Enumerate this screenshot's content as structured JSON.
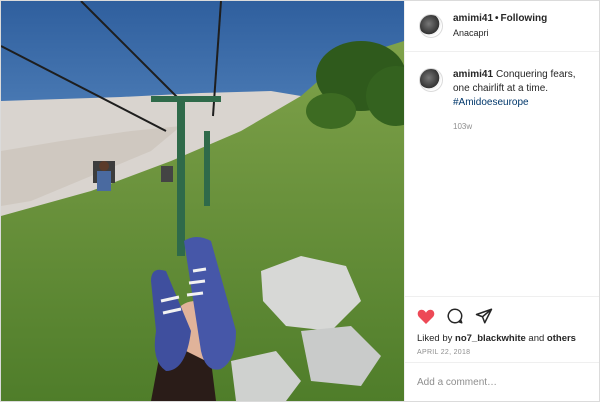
{
  "post": {
    "username": "amimi41",
    "separator": "•",
    "follow_status": "Following",
    "location": "Anacapri",
    "caption_username": "amimi41",
    "caption_text": "Conquering fears, one chairlift at a time.",
    "hashtag": "#Amidoeseurope",
    "time_ago": "103w",
    "likes_prefix": "Liked by",
    "likes_user": "no7_blackwhite",
    "likes_and": "and",
    "likes_others": "others",
    "date": "APRIL 22, 2018",
    "comment_placeholder": "Add a comment…"
  },
  "icons": {
    "like": "heart-icon",
    "comment": "comment-icon",
    "share": "share-icon"
  },
  "colors": {
    "like_red": "#ed4956",
    "hashtag_blue": "#00376b",
    "muted_gray": "#8e8e8e"
  }
}
